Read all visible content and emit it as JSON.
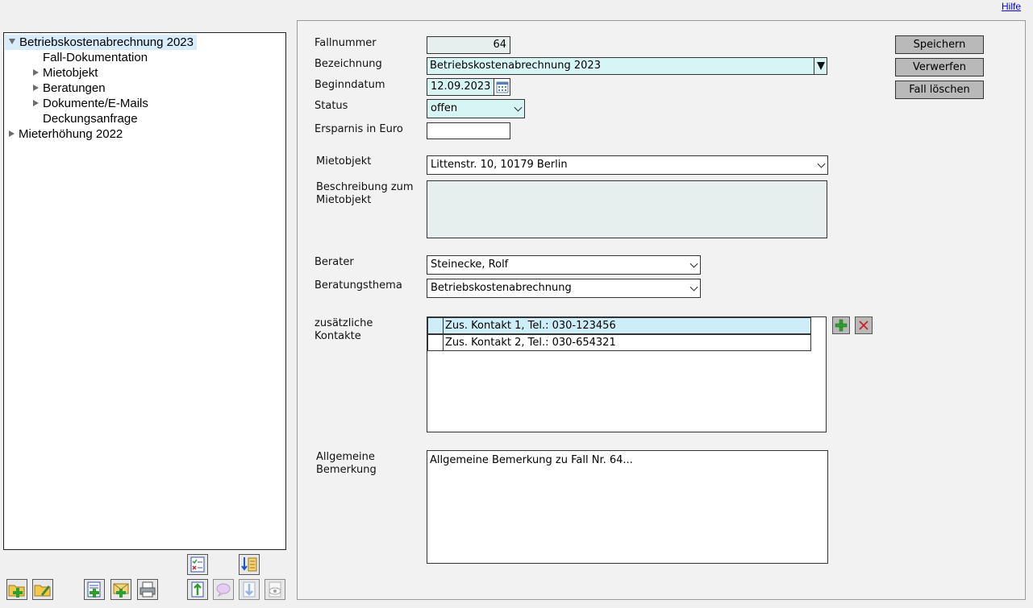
{
  "header": {
    "help_link": "Hilfe"
  },
  "tree": {
    "items": [
      {
        "label": "Betriebskostenabrechnung 2023",
        "level": 0,
        "arrow": "down",
        "selected": true
      },
      {
        "label": "Fall-Dokumentation",
        "level": 1,
        "arrow": "none"
      },
      {
        "label": "Mietobjekt",
        "level": 1,
        "arrow": "right"
      },
      {
        "label": "Beratungen",
        "level": 1,
        "arrow": "right"
      },
      {
        "label": "Dokumente/E-Mails",
        "level": 1,
        "arrow": "right"
      },
      {
        "label": "Deckungsanfrage",
        "level": 1,
        "arrow": "none"
      },
      {
        "label": "Mieterhöhung 2022",
        "level": 0,
        "arrow": "right"
      }
    ]
  },
  "toolbar": {
    "buttons": [
      {
        "icon": "new-folder-icon",
        "enabled": true
      },
      {
        "icon": "edit-folder-icon",
        "enabled": true
      },
      {
        "icon": "new-document-icon",
        "enabled": true
      },
      {
        "icon": "new-email-icon",
        "enabled": true
      },
      {
        "icon": "printer-icon",
        "enabled": true
      },
      {
        "icon": "checklist-icon",
        "enabled": true
      },
      {
        "icon": "sort-icon",
        "enabled": true
      },
      {
        "icon": "move-up-icon",
        "enabled": true
      },
      {
        "icon": "comment-icon",
        "enabled": false
      },
      {
        "icon": "move-down-icon",
        "enabled": false
      },
      {
        "icon": "preview-icon",
        "enabled": false
      }
    ]
  },
  "form": {
    "fallnummer": {
      "label": "Fallnummer",
      "value": "64"
    },
    "bezeichnung": {
      "label": "Bezeichnung",
      "value": "Betriebskostenabrechnung 2023"
    },
    "beginndatum": {
      "label": "Beginndatum",
      "value": "12.09.2023"
    },
    "status": {
      "label": "Status",
      "value": "offen"
    },
    "ersparnis": {
      "label": "Ersparnis in Euro",
      "value": ""
    },
    "mietobjekt": {
      "label": "Mietobjekt",
      "value": "Littenstr. 10, 10179 Berlin"
    },
    "beschreibung": {
      "label_line1": "Beschreibung zum",
      "label_line2": "Mietobjekt",
      "value": ""
    },
    "berater": {
      "label": "Berater",
      "value": "Steinecke, Rolf"
    },
    "beratungsthema": {
      "label": "Beratungsthema",
      "value": "Betriebskostenabrechnung"
    },
    "kontakte": {
      "label_line1": "zusätzliche",
      "label_line2": "Kontakte",
      "rows": [
        {
          "text": "Zus. Kontakt 1, Tel.: 030-123456",
          "selected": true
        },
        {
          "text": "Zus. Kontakt 2, Tel.: 030-654321",
          "selected": false
        }
      ]
    },
    "bemerkung": {
      "label_line1": "Allgemeine",
      "label_line2": "Bemerkung",
      "value": "Allgemeine Bemerkung zu Fall Nr. 64..."
    }
  },
  "actions": {
    "save": "Speichern",
    "discard": "Verwerfen",
    "delete": "Fall löschen"
  },
  "colors": {
    "accent_field": "#d8f5f5",
    "readonly_field": "#e6eeee",
    "selection": "#d9ecfb",
    "button": "#b9b9b9",
    "add_green": "#2e9e2e",
    "delete_red": "#cc2222"
  }
}
